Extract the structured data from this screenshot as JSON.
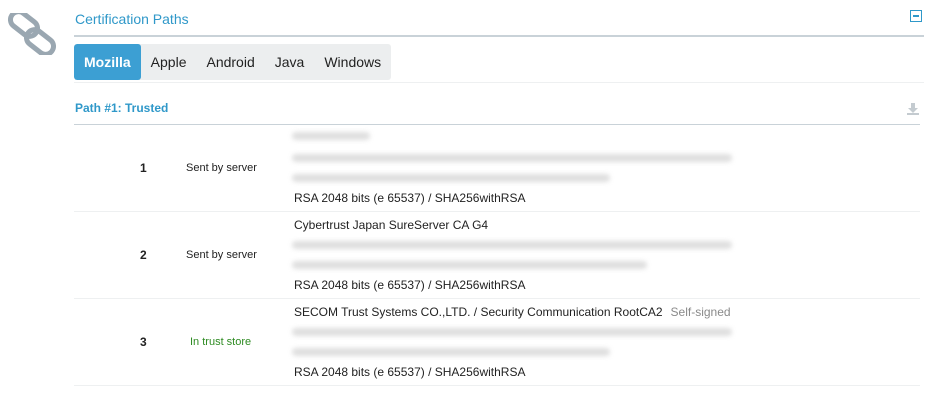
{
  "section": {
    "title": "Certification Paths"
  },
  "tabs": [
    {
      "label": "Mozilla",
      "active": true
    },
    {
      "label": "Apple",
      "active": false
    },
    {
      "label": "Android",
      "active": false
    },
    {
      "label": "Java",
      "active": false
    },
    {
      "label": "Windows",
      "active": false
    }
  ],
  "path": {
    "title": "Path #1: Trusted"
  },
  "certs": [
    {
      "num": "1",
      "status": "Sent by server",
      "name": "",
      "key": "RSA 2048 bits (e 65537) / SHA256withRSA"
    },
    {
      "num": "2",
      "status": "Sent by server",
      "name": "Cybertrust Japan SureServer CA G4",
      "key": "RSA 2048 bits (e 65537) / SHA256withRSA"
    },
    {
      "num": "3",
      "status": "In trust store",
      "name": "SECOM Trust Systems CO.,LTD. / Security Communication RootCA2",
      "self_signed": "Self-signed",
      "key": "RSA 2048 bits (e 65537) / SHA256withRSA"
    }
  ],
  "colors": {
    "accent": "#2f98c9",
    "tab_active": "#3c9fd3",
    "trusted": "#2e8b22"
  },
  "icons": {
    "logo": "chain-links-icon",
    "collapse": "collapse-minus-icon",
    "download": "download-icon"
  }
}
